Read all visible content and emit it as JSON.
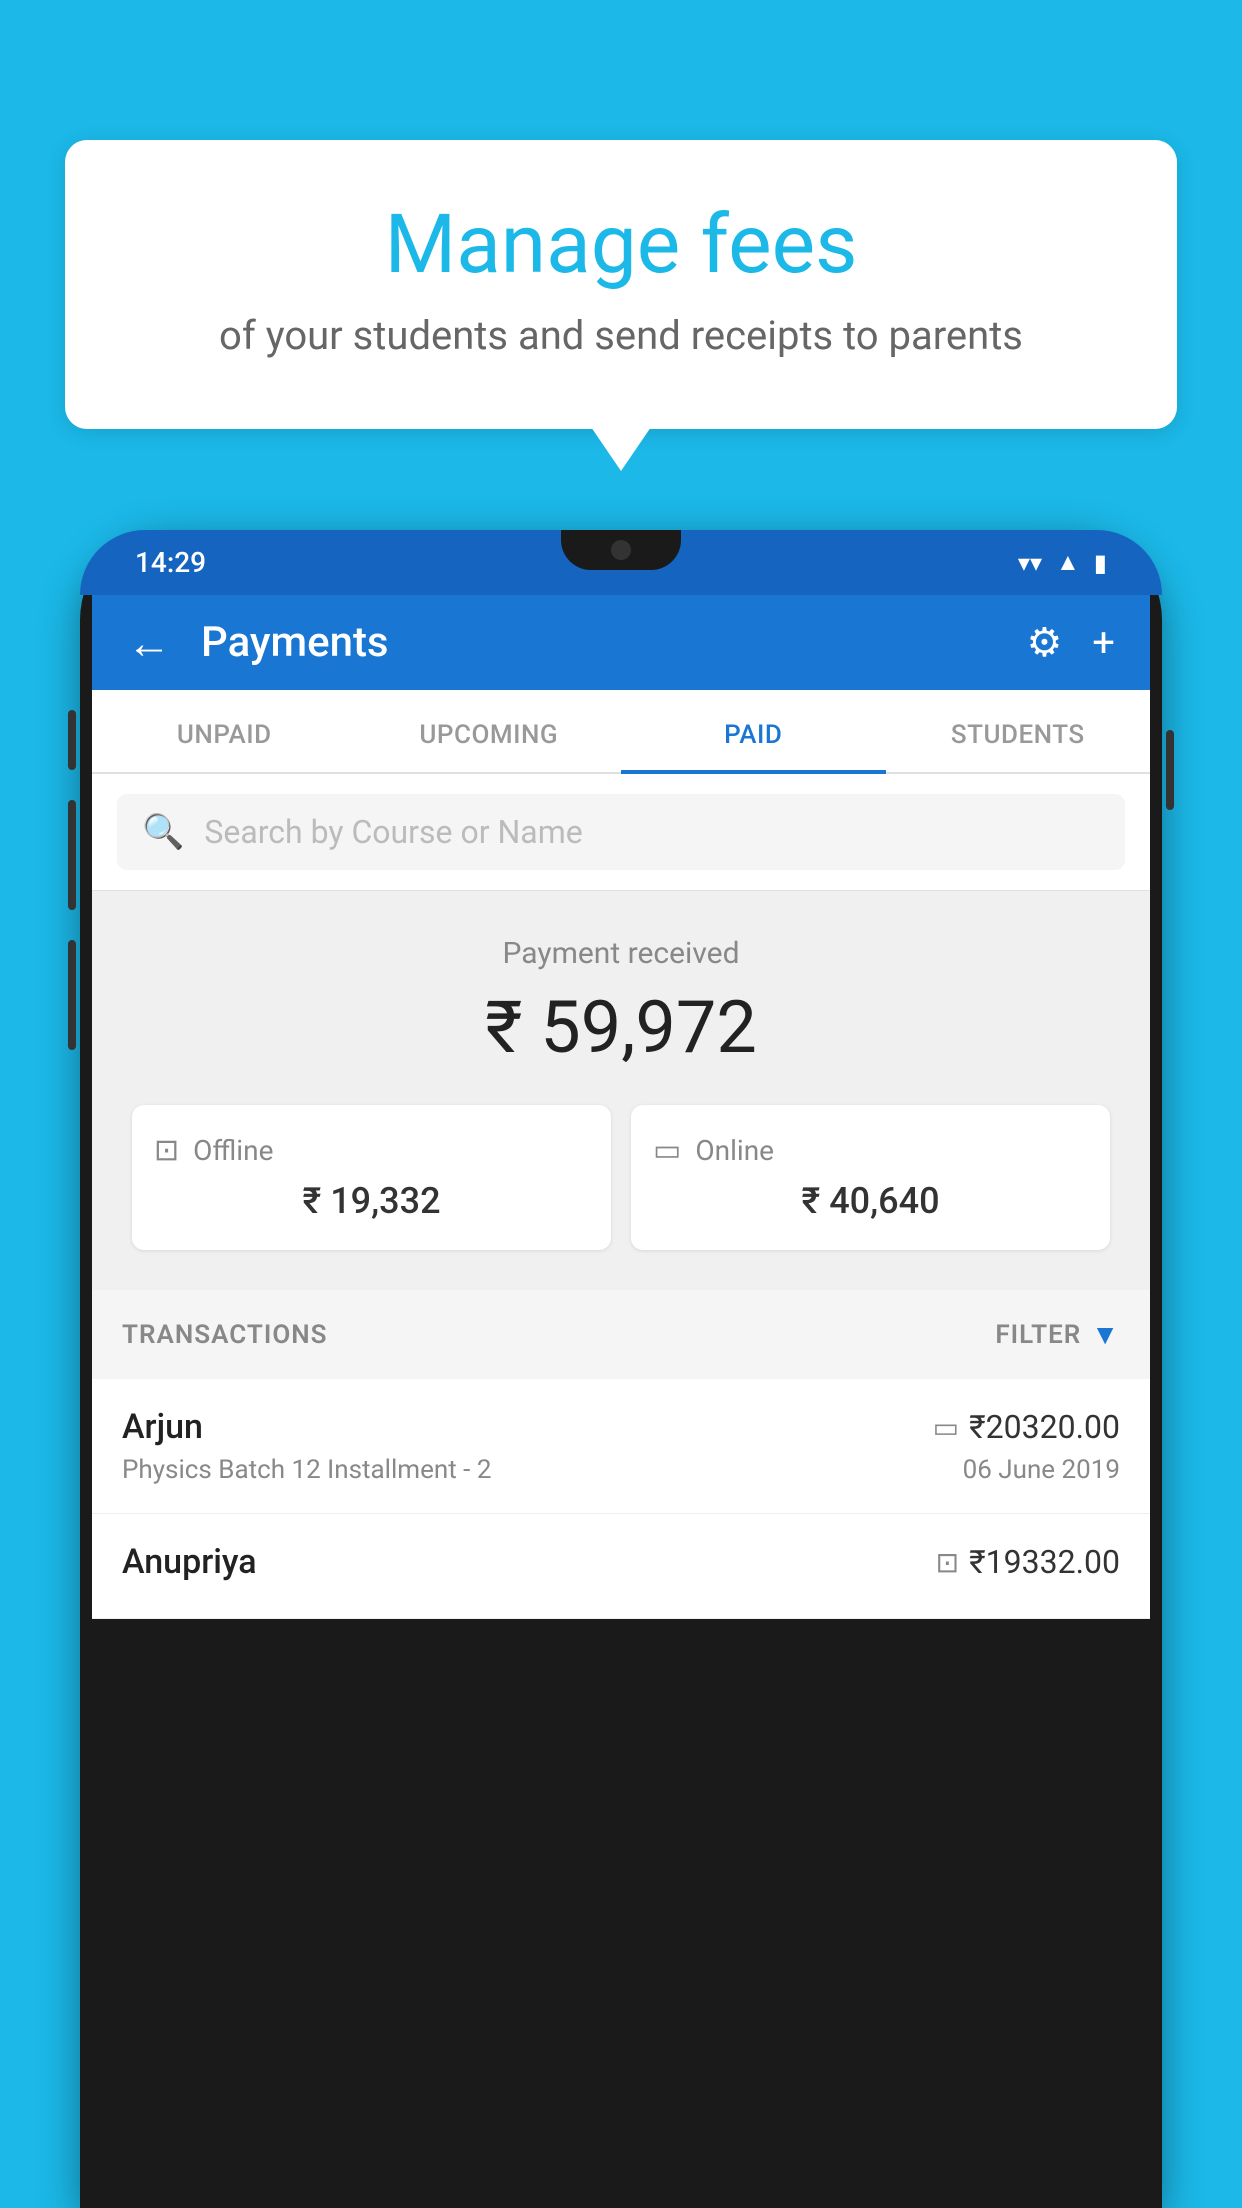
{
  "bubble": {
    "title": "Manage fees",
    "subtitle": "of your students and send receipts to parents"
  },
  "phone": {
    "status_bar": {
      "time": "14:29",
      "icons": [
        "wifi",
        "signal",
        "battery"
      ]
    },
    "app_bar": {
      "title": "Payments",
      "back_label": "←",
      "settings_label": "⚙",
      "add_label": "+"
    },
    "tabs": [
      {
        "label": "UNPAID",
        "active": false
      },
      {
        "label": "UPCOMING",
        "active": false
      },
      {
        "label": "PAID",
        "active": true
      },
      {
        "label": "STUDENTS",
        "active": false
      }
    ],
    "search": {
      "placeholder": "Search by Course or Name"
    },
    "payment_summary": {
      "label": "Payment received",
      "amount": "₹ 59,972",
      "offline": {
        "label": "Offline",
        "amount": "₹ 19,332"
      },
      "online": {
        "label": "Online",
        "amount": "₹ 40,640"
      }
    },
    "transactions": {
      "section_label": "TRANSACTIONS",
      "filter_label": "FILTER",
      "items": [
        {
          "name": "Arjun",
          "course": "Physics Batch 12 Installment - 2",
          "amount": "₹20320.00",
          "date": "06 June 2019",
          "payment_type": "online"
        },
        {
          "name": "Anupriya",
          "course": "",
          "amount": "₹19332.00",
          "date": "",
          "payment_type": "offline"
        }
      ]
    }
  }
}
